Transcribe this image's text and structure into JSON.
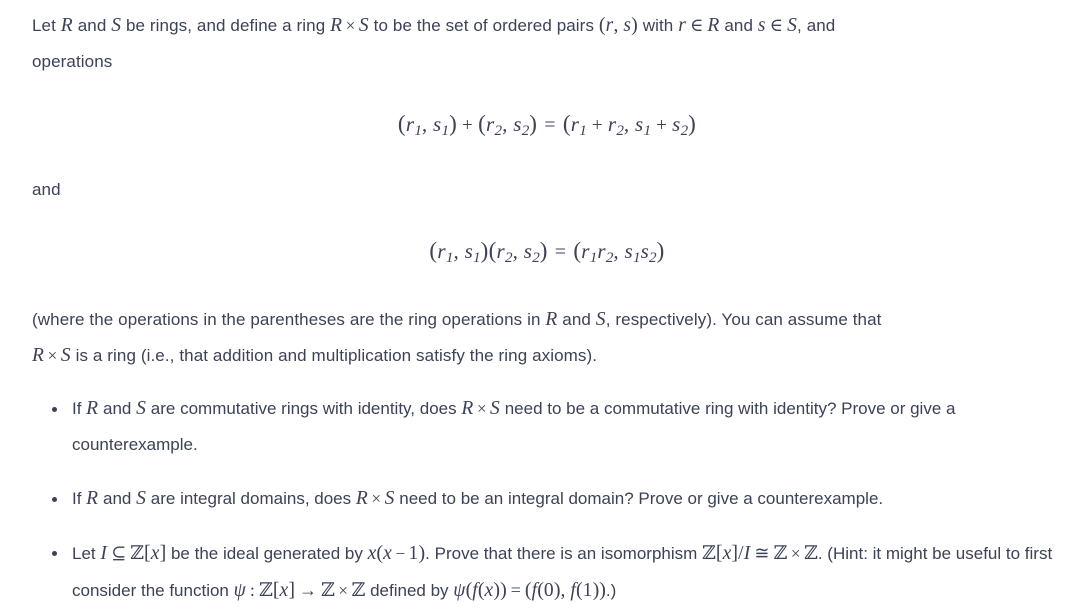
{
  "document": {
    "type": "math-problem-set",
    "text_color": "#3c4257",
    "background_color": "#ffffff",
    "intro": {
      "s1": "Let ",
      "var_R": "R",
      "s2": " and ",
      "var_S": "S",
      "s3": " be rings, and define a ring ",
      "prod_R": "R",
      "times": "×",
      "prod_S": "S",
      "s4": " to be the set of ordered pairs ",
      "pair_open": "(",
      "pair_r": "r",
      "pair_comma": ",",
      "pair_s": "s",
      "pair_close": ")",
      "s5": " with ",
      "elem_r": "r",
      "in1": "∈",
      "elem_R": "R",
      "s6": " and ",
      "elem_s": "s",
      "in2": "∈",
      "elem_S": "S",
      "s7": ", and",
      "s8": "operations"
    },
    "equation_add": {
      "latex": "(r_1, s_1) + (r_2, s_2) = (r_1 + r_2, s_1 + s_2)",
      "lhs_open": "(",
      "lhs_r": "r",
      "lhs_r_sub": "1",
      "lhs_comma": ",",
      "lhs_s": "s",
      "lhs_s_sub": "1",
      "lhs_close": ")",
      "plus_outer": "+",
      "lhs2_open": "(",
      "lhs2_r": "r",
      "lhs2_r_sub": "2",
      "lhs2_comma": ",",
      "lhs2_s": "s",
      "lhs2_s_sub": "2",
      "lhs2_close": ")",
      "equals": "=",
      "rhs_open": "(",
      "rhs_r1": "r",
      "rhs_r1_sub": "1",
      "rhs_plus1": "+",
      "rhs_r2": "r",
      "rhs_r2_sub": "2",
      "rhs_comma": ",",
      "rhs_s1": "s",
      "rhs_s1_sub": "1",
      "rhs_plus2": "+",
      "rhs_s2": "s",
      "rhs_s2_sub": "2",
      "rhs_close": ")"
    },
    "connector": "and",
    "equation_mult": {
      "latex": "(r_1, s_1)(r_2, s_2) = (r_1 r_2, s_1 s_2)",
      "lhs_open": "(",
      "lhs_r": "r",
      "lhs_r_sub": "1",
      "lhs_comma": ",",
      "lhs_s": "s",
      "lhs_s_sub": "1",
      "lhs_close": ")",
      "lhs2_open": "(",
      "lhs2_r": "r",
      "lhs2_r_sub": "2",
      "lhs2_comma": ",",
      "lhs2_s": "s",
      "lhs2_s_sub": "2",
      "lhs2_close": ")",
      "equals": "=",
      "rhs_open": "(",
      "rhs_r1": "r",
      "rhs_r1_sub": "1",
      "rhs_r2": "r",
      "rhs_r2_sub": "2",
      "rhs_comma": ",",
      "rhs_s1": "s",
      "rhs_s1_sub": "1",
      "rhs_s2": "s",
      "rhs_s2_sub": "2",
      "rhs_close": ")"
    },
    "assumption": {
      "s1": "(where the operations in the parentheses are the ring operations in ",
      "var_R": "R",
      "s2": " and ",
      "var_S": "S",
      "s3": ", respectively). You can assume that",
      "prod_R": "R",
      "times": "×",
      "prod_S": "S",
      "s4": " is a ring (i.e., that addition and multiplication satisfy the ring axioms)."
    },
    "items": [
      {
        "id": "item-commutative-identity",
        "s1": "If ",
        "var_R": "R",
        "s2": " and ",
        "var_S": "S",
        "s3": " are commutative rings with identity, does ",
        "prod_R": "R",
        "times": "×",
        "prod_S": "S",
        "s4": " need to be a commutative ring with identity? Prove or give a counterexample."
      },
      {
        "id": "item-integral-domain",
        "s1": "If ",
        "var_R": "R",
        "s2": " and ",
        "var_S": "S",
        "s3": " are integral domains, does ",
        "prod_R": "R",
        "times": "×",
        "prod_S": "S",
        "s4": " need to be an integral domain? Prove or give a counterexample."
      },
      {
        "id": "item-isomorphism",
        "s1": "Let ",
        "var_I": "I",
        "subset": "⊆",
        "Z1": "ℤ",
        "br_open1": "[",
        "x1": "x",
        "br_close1": "]",
        "s2": " be the ideal generated by ",
        "gen_x": "x",
        "gen_open": "(",
        "gen_x2": "x",
        "minus": "−",
        "gen_one": "1",
        "gen_close": ")",
        "s3": ". Prove that there is an isomorphism ",
        "Z2": "ℤ",
        "br_open2": "[",
        "x2": "x",
        "br_close2": "]",
        "slash": "/",
        "var_I2": "I",
        "cong": "≅",
        "Z3": "ℤ",
        "times": "×",
        "Z4": "ℤ",
        "s4": ". (Hint: it might be useful to first consider the function ",
        "psi": "ψ",
        "colon": ":",
        "Z5": "ℤ",
        "br_open3": "[",
        "x3": "x",
        "br_close3": "]",
        "arrow": "→",
        "Z6": "ℤ",
        "times2": "×",
        "Z7": "ℤ",
        "s5": " defined by ",
        "psi2": "ψ",
        "p_open": "(",
        "f1": "f",
        "f1_open": "(",
        "f1_x": "x",
        "f1_close": ")",
        "p_close": ")",
        "equals": "=",
        "r_open": "(",
        "f2": "f",
        "f2_open": "(",
        "f2_zero": "0",
        "f2_close": ")",
        "r_comma": ",",
        "f3": "f",
        "f3_open": "(",
        "f3_one": "1",
        "f3_close": ")",
        "r_close": ")",
        "s6": ".)"
      }
    ]
  }
}
